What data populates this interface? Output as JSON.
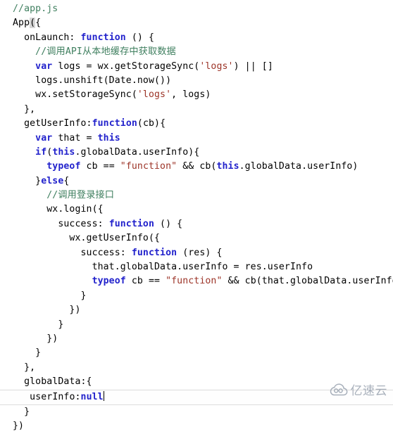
{
  "editor": {
    "filename_comment": "//app.js",
    "theme": {
      "background": "#ffffff",
      "text": "#000000",
      "comment": "#3f7f5f",
      "keyword": "#2222cc",
      "string": "#9c3327",
      "bracket_match_bg": "#d6d6d6",
      "current_line_border": "#dcdcdc"
    },
    "caret_line_index": 27
  },
  "code": {
    "lines": [
      {
        "indent": 0,
        "tokens": [
          {
            "t": "comment",
            "v": "//app.js"
          }
        ]
      },
      {
        "indent": 0,
        "tokens": [
          {
            "t": "plain",
            "v": "App"
          },
          {
            "t": "bracket-match",
            "v": "("
          },
          {
            "t": "plain",
            "v": "{"
          }
        ]
      },
      {
        "indent": 1,
        "tokens": [
          {
            "t": "plain",
            "v": "onLaunch: "
          },
          {
            "t": "keyword",
            "v": "function"
          },
          {
            "t": "plain",
            "v": " () {"
          }
        ]
      },
      {
        "indent": 2,
        "tokens": [
          {
            "t": "comment",
            "v": "//调用API从本地缓存中获取数据"
          }
        ]
      },
      {
        "indent": 2,
        "tokens": [
          {
            "t": "keyword",
            "v": "var"
          },
          {
            "t": "plain",
            "v": " logs = wx.getStorageSync("
          },
          {
            "t": "string",
            "v": "'logs'"
          },
          {
            "t": "plain",
            "v": ") || []"
          }
        ]
      },
      {
        "indent": 2,
        "tokens": [
          {
            "t": "plain",
            "v": "logs.unshift(Date.now())"
          }
        ]
      },
      {
        "indent": 2,
        "tokens": [
          {
            "t": "plain",
            "v": "wx.setStorageSync("
          },
          {
            "t": "string",
            "v": "'logs'"
          },
          {
            "t": "plain",
            "v": ", logs)"
          }
        ]
      },
      {
        "indent": 1,
        "tokens": [
          {
            "t": "plain",
            "v": "},"
          }
        ]
      },
      {
        "indent": 1,
        "tokens": [
          {
            "t": "plain",
            "v": "getUserInfo:"
          },
          {
            "t": "keyword",
            "v": "function"
          },
          {
            "t": "plain",
            "v": "(cb){"
          }
        ]
      },
      {
        "indent": 2,
        "tokens": [
          {
            "t": "keyword",
            "v": "var"
          },
          {
            "t": "plain",
            "v": " that = "
          },
          {
            "t": "keyword",
            "v": "this"
          }
        ]
      },
      {
        "indent": 2,
        "tokens": [
          {
            "t": "keyword",
            "v": "if"
          },
          {
            "t": "plain",
            "v": "("
          },
          {
            "t": "keyword",
            "v": "this"
          },
          {
            "t": "plain",
            "v": ".globalData.userInfo){"
          }
        ]
      },
      {
        "indent": 3,
        "tokens": [
          {
            "t": "keyword",
            "v": "typeof"
          },
          {
            "t": "plain",
            "v": " cb == "
          },
          {
            "t": "string",
            "v": "\"function\""
          },
          {
            "t": "plain",
            "v": " && cb("
          },
          {
            "t": "keyword",
            "v": "this"
          },
          {
            "t": "plain",
            "v": ".globalData.userInfo)"
          }
        ]
      },
      {
        "indent": 2,
        "tokens": [
          {
            "t": "plain",
            "v": "}"
          },
          {
            "t": "keyword",
            "v": "else"
          },
          {
            "t": "plain",
            "v": "{"
          }
        ]
      },
      {
        "indent": 3,
        "tokens": [
          {
            "t": "comment",
            "v": "//调用登录接口"
          }
        ]
      },
      {
        "indent": 3,
        "tokens": [
          {
            "t": "plain",
            "v": "wx.login({"
          }
        ]
      },
      {
        "indent": 4,
        "tokens": [
          {
            "t": "plain",
            "v": "success: "
          },
          {
            "t": "keyword",
            "v": "function"
          },
          {
            "t": "plain",
            "v": " () {"
          }
        ]
      },
      {
        "indent": 5,
        "tokens": [
          {
            "t": "plain",
            "v": "wx.getUserInfo({"
          }
        ]
      },
      {
        "indent": 6,
        "tokens": [
          {
            "t": "plain",
            "v": "success: "
          },
          {
            "t": "keyword",
            "v": "function"
          },
          {
            "t": "plain",
            "v": " (res) {"
          }
        ]
      },
      {
        "indent": 7,
        "tokens": [
          {
            "t": "plain",
            "v": "that.globalData.userInfo = res.userInfo"
          }
        ]
      },
      {
        "indent": 7,
        "tokens": [
          {
            "t": "keyword",
            "v": "typeof"
          },
          {
            "t": "plain",
            "v": " cb == "
          },
          {
            "t": "string",
            "v": "\"function\""
          },
          {
            "t": "plain",
            "v": " && cb(that.globalData.userInfo)"
          }
        ]
      },
      {
        "indent": 6,
        "tokens": [
          {
            "t": "plain",
            "v": "}"
          }
        ]
      },
      {
        "indent": 5,
        "tokens": [
          {
            "t": "plain",
            "v": "})"
          }
        ]
      },
      {
        "indent": 4,
        "tokens": [
          {
            "t": "plain",
            "v": "}"
          }
        ]
      },
      {
        "indent": 3,
        "tokens": [
          {
            "t": "plain",
            "v": "})"
          }
        ]
      },
      {
        "indent": 2,
        "tokens": [
          {
            "t": "plain",
            "v": "}"
          }
        ]
      },
      {
        "indent": 1,
        "tokens": [
          {
            "t": "plain",
            "v": "},"
          }
        ]
      },
      {
        "indent": 1,
        "tokens": [
          {
            "t": "plain",
            "v": "globalData:{"
          }
        ]
      },
      {
        "indent": 2,
        "tokens": [
          {
            "t": "plain",
            "v": "userInfo:"
          },
          {
            "t": "keyword",
            "v": "null"
          }
        ]
      },
      {
        "indent": 1,
        "tokens": [
          {
            "t": "plain",
            "v": "}"
          }
        ]
      },
      {
        "indent": 0,
        "tokens": [
          {
            "t": "plain",
            "v": "})"
          }
        ]
      }
    ]
  },
  "watermark": {
    "text": "亿速云",
    "icon": "cloud-icon",
    "color": "#9aa3b0"
  }
}
